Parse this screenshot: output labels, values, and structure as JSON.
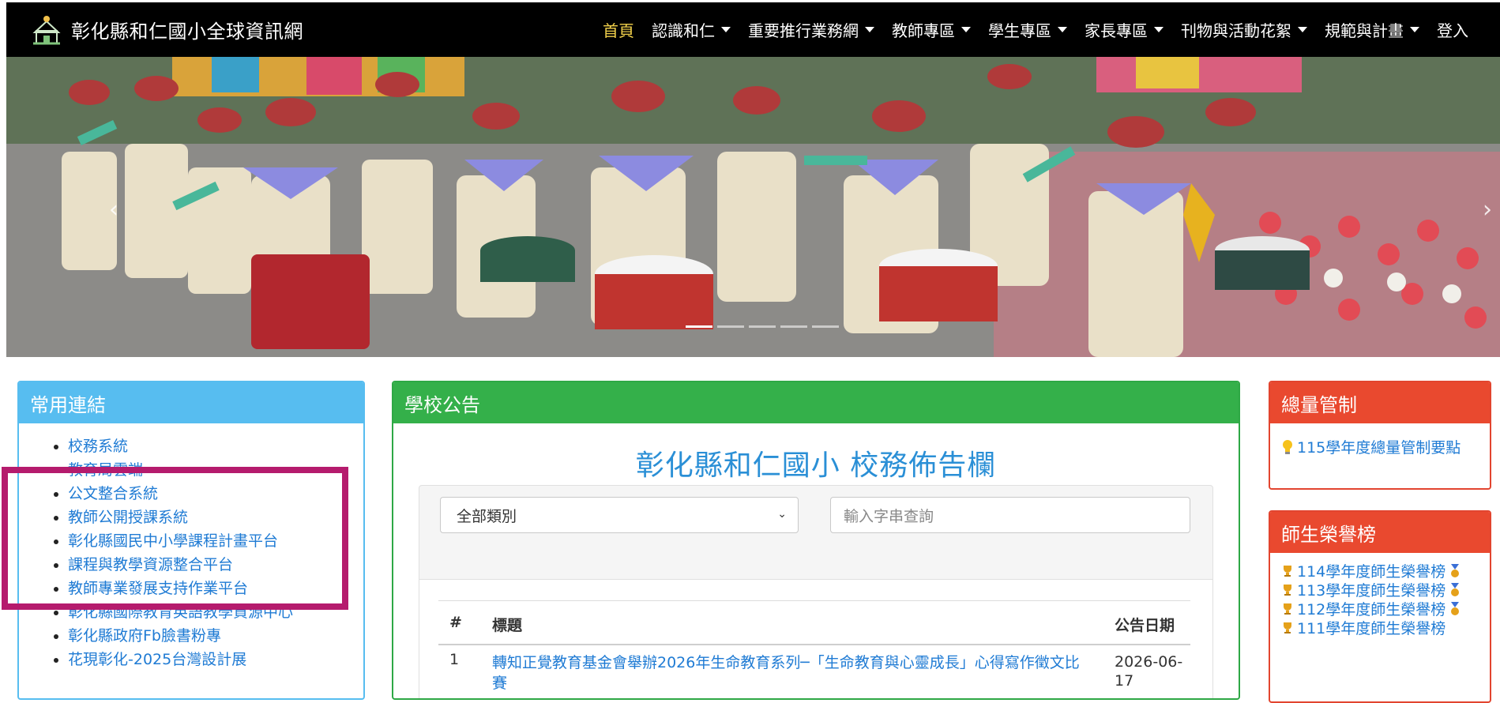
{
  "navbar": {
    "brand_title": "彰化縣和仁國小全球資訊網",
    "logo_icon": "school-logo-icon",
    "items": [
      {
        "label": "首頁",
        "active": true,
        "dropdown": false
      },
      {
        "label": "認識和仁",
        "active": false,
        "dropdown": true
      },
      {
        "label": "重要推行業務網",
        "active": false,
        "dropdown": true
      },
      {
        "label": "教師專區",
        "active": false,
        "dropdown": true
      },
      {
        "label": "學生專區",
        "active": false,
        "dropdown": true
      },
      {
        "label": "家長專區",
        "active": false,
        "dropdown": true
      },
      {
        "label": "刊物與活動花絮",
        "active": false,
        "dropdown": true
      },
      {
        "label": "規範與計畫",
        "active": false,
        "dropdown": true
      },
      {
        "label": "登入",
        "active": false,
        "dropdown": false
      }
    ]
  },
  "hero": {
    "prev_icon": "‹",
    "next_icon": "›",
    "slide_count": 5,
    "active_slide": 1
  },
  "links_panel": {
    "title": "常用連結",
    "items": [
      "校務系統",
      "教育局雲端",
      "公文整合系統",
      "教師公開授課系統",
      "彰化縣國民中小學課程計畫平台",
      "課程與教學資源整合平台",
      "教師專業發展支持作業平台",
      "彰化縣國際教育英語教學資源中心",
      "彰化縣政府Fb臉書粉專",
      "花現彰化-2025台灣設計展"
    ]
  },
  "news_panel": {
    "title": "學校公告",
    "board_title": "彰化縣和仁國小 校務佈告欄",
    "category_select": "全部類別",
    "search_placeholder": "輸入字串查詢",
    "table": {
      "headers": {
        "num": "#",
        "title": "標題",
        "date": "公告日期"
      },
      "rows": [
        {
          "num": "1",
          "title": "轉知正覺教育基金會舉辦2026年生命教育系列─「生命教育與心靈成長」心得寫作徵文比賽",
          "date": "2026-06-17"
        }
      ]
    }
  },
  "quota_panel": {
    "title": "總量管制",
    "item": "115學年度總量管制要點"
  },
  "honor_panel": {
    "title": "師生榮譽榜",
    "items": [
      "114學年度師生榮譽榜",
      "113學年度師生榮譽榜",
      "112學年度師生榮譽榜",
      "111學年度師生榮譽榜"
    ]
  },
  "colors": {
    "navbar_bg": "#000000",
    "nav_active": "#f2d14b",
    "links_header": "#57bdf0",
    "news_header": "#34b04a",
    "right_header": "#e9492f",
    "link_text": "#1f7bd4",
    "highlight": "#b51b6d"
  }
}
